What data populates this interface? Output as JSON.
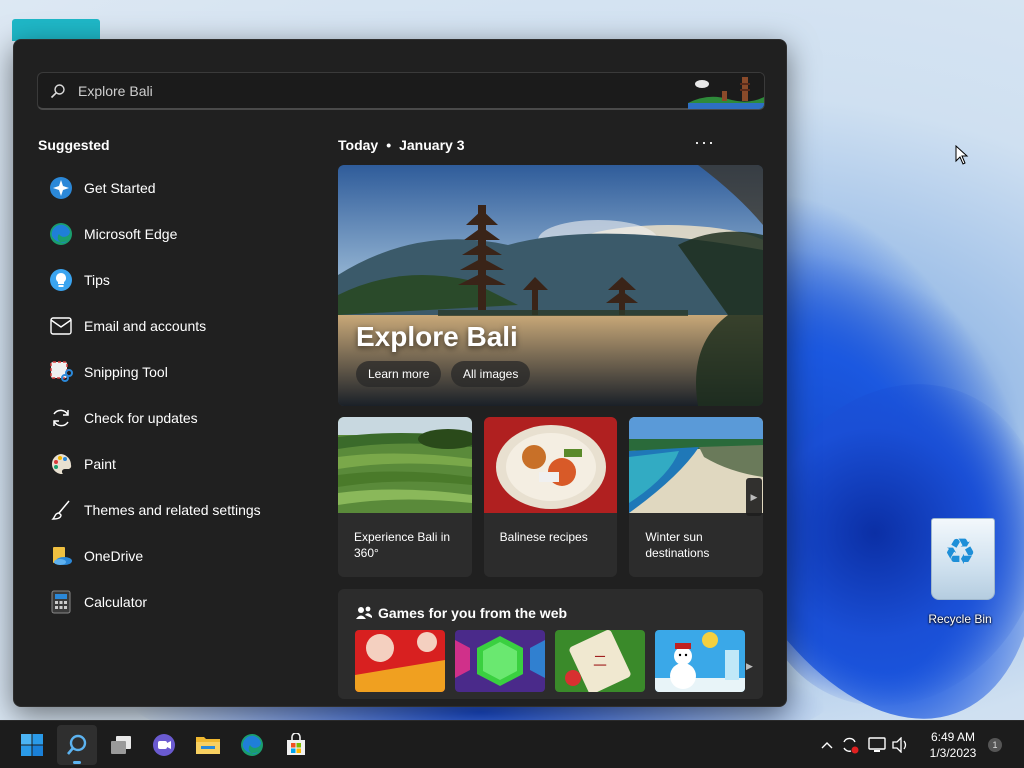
{
  "search": {
    "placeholder": "Explore Bali"
  },
  "suggested": {
    "title": "Suggested",
    "items": [
      {
        "label": "Get Started",
        "icon": "get-started-icon"
      },
      {
        "label": "Microsoft Edge",
        "icon": "edge-icon"
      },
      {
        "label": "Tips",
        "icon": "tips-icon"
      },
      {
        "label": "Email and accounts",
        "icon": "mail-icon"
      },
      {
        "label": "Snipping Tool",
        "icon": "snipping-tool-icon"
      },
      {
        "label": "Check for updates",
        "icon": "refresh-icon"
      },
      {
        "label": "Paint",
        "icon": "paint-icon"
      },
      {
        "label": "Themes and related settings",
        "icon": "brush-icon"
      },
      {
        "label": "OneDrive",
        "icon": "onedrive-icon"
      },
      {
        "label": "Calculator",
        "icon": "calculator-icon"
      }
    ]
  },
  "today": {
    "label": "Today",
    "date": "January 3",
    "more": "···"
  },
  "hero": {
    "title": "Explore Bali",
    "learn_more": "Learn more",
    "all_images": "All images"
  },
  "cards": [
    {
      "caption": "Experience Bali in 360°"
    },
    {
      "caption": "Balinese recipes"
    },
    {
      "caption": "Winter sun destinations"
    }
  ],
  "games": {
    "title": "Games for you from the web"
  },
  "desktop": {
    "recycle_bin": "Recycle Bin"
  },
  "taskbar": {
    "apps": [
      "start-icon",
      "search-icon",
      "task-view-icon",
      "chat-icon",
      "file-explorer-icon",
      "edge-icon",
      "store-icon"
    ],
    "time": "6:49 AM",
    "date": "1/3/2023",
    "notifications": "1"
  },
  "colors": {
    "panel_bg": "#202020",
    "card_bg": "#2c2c2c",
    "accent": "#5cb3f0",
    "taskbar_bg": "#1c1c1c"
  }
}
